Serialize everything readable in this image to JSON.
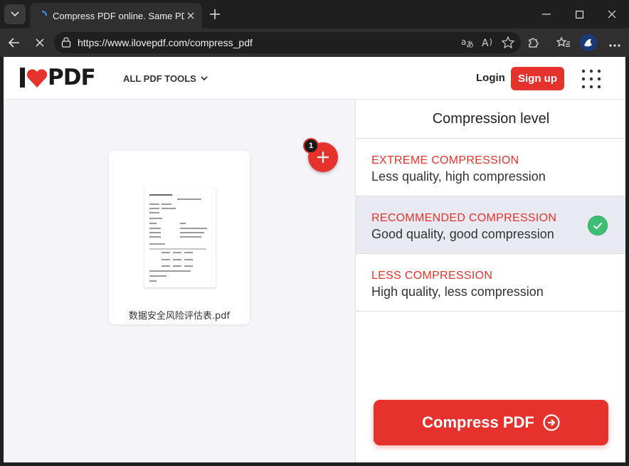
{
  "browser": {
    "tab_title": "Compress PDF online. Same PDF q",
    "url": "https://www.ilovepdf.com/compress_pdf"
  },
  "header": {
    "logo_text": "PDF",
    "tools_menu": "ALL PDF TOOLS",
    "login": "Login",
    "signup": "Sign up"
  },
  "workspace": {
    "file_name": "数据安全风险评估表.pdf",
    "file_count_badge": "1"
  },
  "sidebar": {
    "title": "Compression level",
    "options": [
      {
        "title": "EXTREME COMPRESSION",
        "desc": "Less quality, high compression",
        "selected": false
      },
      {
        "title": "RECOMMENDED COMPRESSION",
        "desc": "Good quality, good compression",
        "selected": true
      },
      {
        "title": "LESS COMPRESSION",
        "desc": "High quality, less compression",
        "selected": false
      }
    ],
    "action": "Compress PDF"
  },
  "colors": {
    "brand": "#e5322d",
    "check": "#3dbe72"
  }
}
